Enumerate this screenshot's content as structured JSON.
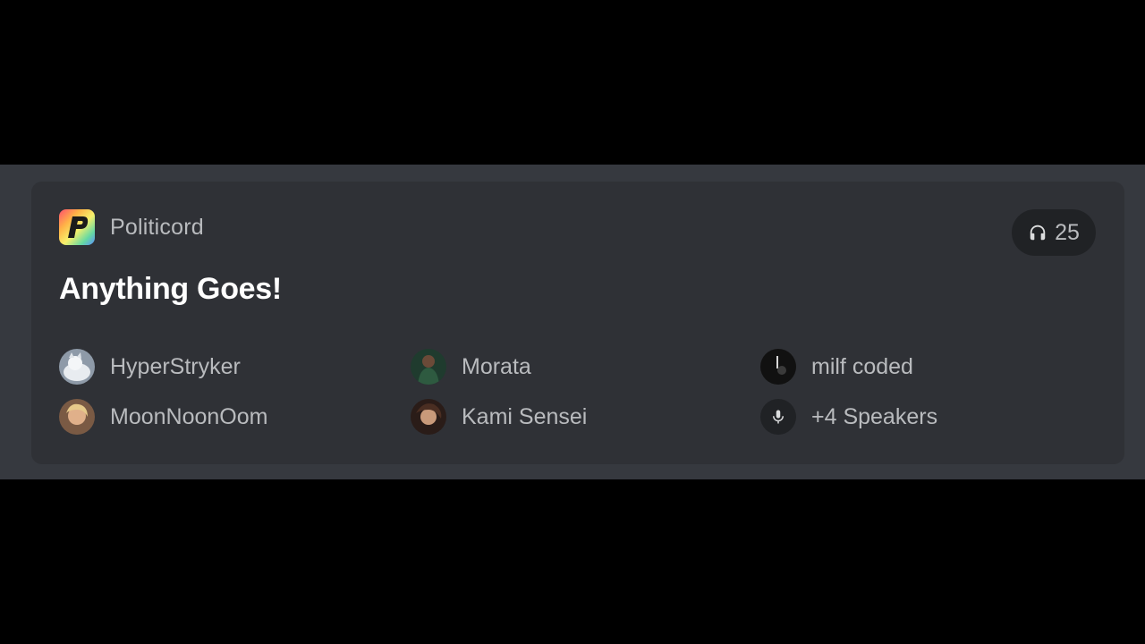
{
  "guild": {
    "name": "Politicord",
    "icon": "politicord-p-logo-rainbow"
  },
  "listeners": {
    "icon": "headphones-icon",
    "count": "25"
  },
  "stage": {
    "title": "Anything Goes!"
  },
  "participants": [
    {
      "name": "HyperStryker",
      "avatar": "white-cat-avatar"
    },
    {
      "name": "Morata",
      "avatar": "dark-green-figure-avatar"
    },
    {
      "name": "milf coded",
      "avatar": "dark-figure-avatar"
    },
    {
      "name": "MoonNoonOom",
      "avatar": "blonde-person-avatar"
    },
    {
      "name": "Kami Sensei",
      "avatar": "anime-character-avatar"
    }
  ],
  "speakers_more": {
    "icon": "microphone-icon",
    "label": "+4 Speakers"
  },
  "colors": {
    "page_bg": "#000000",
    "band_bg": "#36393f",
    "card_bg": "#2f3136",
    "pill_bg": "#202225",
    "text_muted": "#b9bbbe",
    "text_title": "#ffffff"
  }
}
